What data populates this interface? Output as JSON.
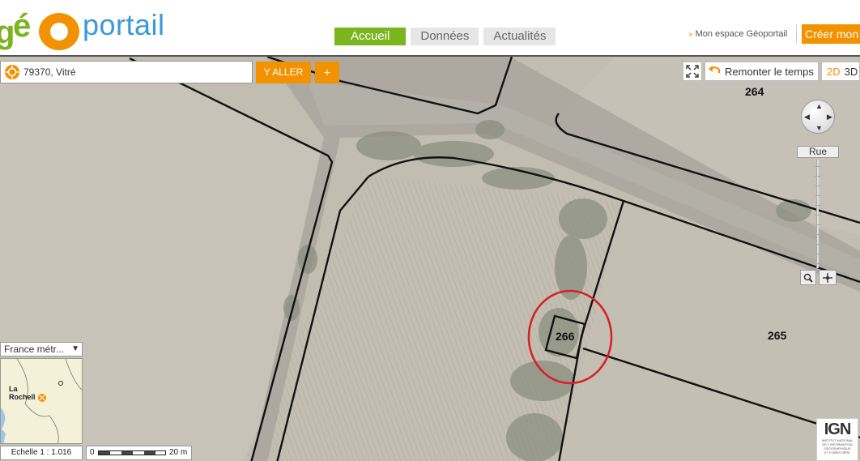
{
  "header": {
    "logo": {
      "g": "g",
      "e": "é",
      "portail": "portail"
    },
    "nav_tabs": [
      {
        "label": "Accueil",
        "active": true
      },
      {
        "label": "Données",
        "active": false
      },
      {
        "label": "Actualités",
        "active": false
      }
    ],
    "espace_link": "Mon espace Géoportail",
    "creer_button": "Créer mon c"
  },
  "search": {
    "value": "79370, Vitré",
    "go_label": "Y ALLER",
    "plus_label": "+"
  },
  "tools": {
    "remonter_label": "Remonter le temps",
    "view_2d": "2D",
    "view_3d": "3D",
    "zoom_level_label": "Rue"
  },
  "parcels": {
    "p264": "264",
    "p265": "265",
    "p266": "266"
  },
  "minimap": {
    "region": "France métr...",
    "city_label_1": "La",
    "city_label_2": "Rochell"
  },
  "scale": {
    "echelle": "Echelle 1 :  1.016",
    "min": "0",
    "max": "20 m"
  },
  "ign": {
    "logo_text": "IGN",
    "line1": "Institut national",
    "line2": "de l'information",
    "line3": "géographique",
    "line4": "et forestière"
  },
  "colors": {
    "accent_green": "#7ab51d",
    "accent_orange": "#f39200",
    "logo_blue": "#3a9ad9",
    "highlight_red": "#d9202a"
  }
}
